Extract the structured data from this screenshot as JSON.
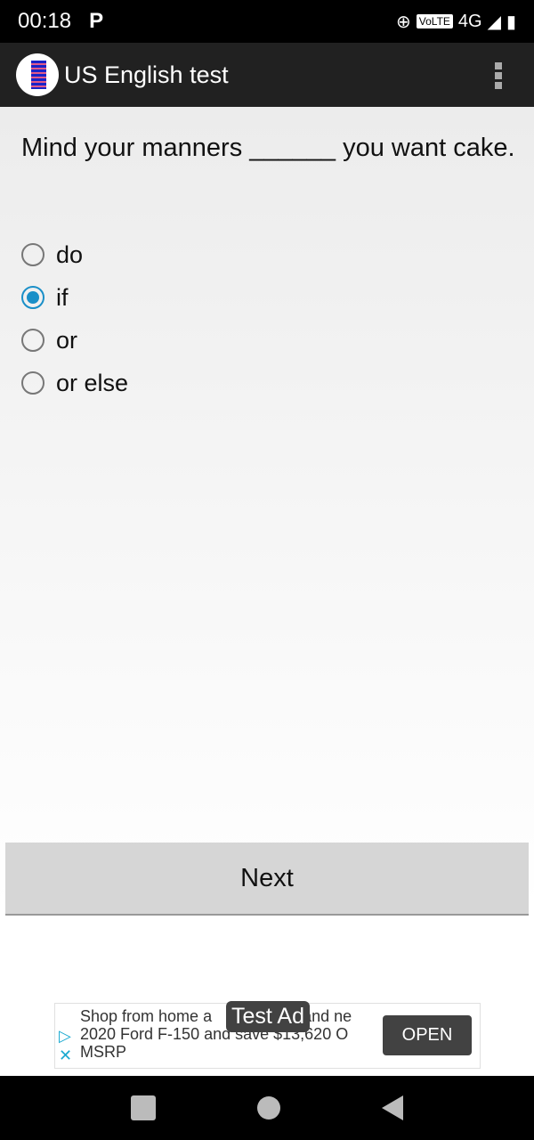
{
  "status_bar": {
    "time": "00:18",
    "notification": "P",
    "volte": "VoLTE",
    "network": "4G",
    "network_small": "4G"
  },
  "app_bar": {
    "title": "US English test",
    "icon": "list-document-icon",
    "menu_icon": "more-vert-icon"
  },
  "question": {
    "text": "Mind your manners ______ you want cake.",
    "options": [
      {
        "label": "do",
        "selected": false
      },
      {
        "label": "if",
        "selected": true
      },
      {
        "label": "or",
        "selected": false
      },
      {
        "label": "or else",
        "selected": false
      }
    ]
  },
  "next_label": "Next",
  "ad": {
    "line1_start": "Shop from home a",
    "line1_end": "rand ne",
    "line2": "2020 Ford F-150 and save $13,620 O",
    "line3": "MSRP",
    "open_label": "OPEN",
    "badge": "Test Ad",
    "accent": "#19a9d0"
  },
  "accent_color": "#1a8fc8"
}
